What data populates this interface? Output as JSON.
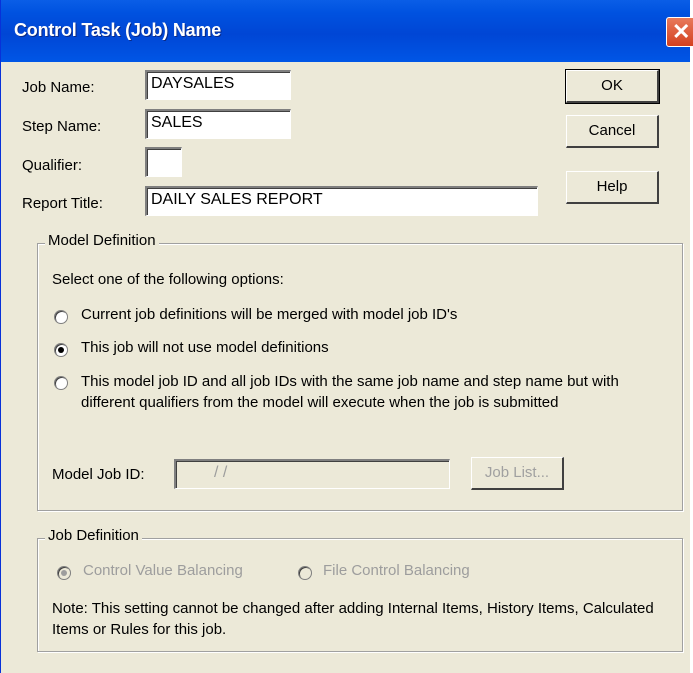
{
  "window": {
    "title": "Control Task (Job) Name",
    "close_glyph": "✕"
  },
  "fields": {
    "job_name": {
      "label": "Job Name:",
      "value": "DAYSALES"
    },
    "step_name": {
      "label": "Step Name:",
      "value": "SALES"
    },
    "qualifier": {
      "label": "Qualifier:",
      "value": ""
    },
    "report_title": {
      "label": "Report Title:",
      "value": "DAILY SALES REPORT"
    }
  },
  "buttons": {
    "ok": "OK",
    "cancel": "Cancel",
    "help": "Help"
  },
  "model_definition": {
    "title": "Model Definition",
    "prompt": "Select one of the following options:",
    "options": [
      {
        "label": "Current job definitions will be merged with model job ID's",
        "selected": false
      },
      {
        "label": "This job will not use model definitions",
        "selected": true
      },
      {
        "label": "This model job ID and all job IDs with the same job name and step name but with different qualifiers from the model will execute when the job is submitted",
        "selected": false
      }
    ],
    "model_job_id_label": "Model Job ID:",
    "model_job_id_value": "/        /",
    "job_list_button": "Job List..."
  },
  "job_definition": {
    "title": "Job Definition",
    "options": [
      {
        "label": "Control Value Balancing",
        "selected": true
      },
      {
        "label": "File Control Balancing",
        "selected": false
      }
    ],
    "note": "Note:  This setting cannot be changed after adding Internal Items, History Items, Calculated Items or Rules for this job."
  }
}
